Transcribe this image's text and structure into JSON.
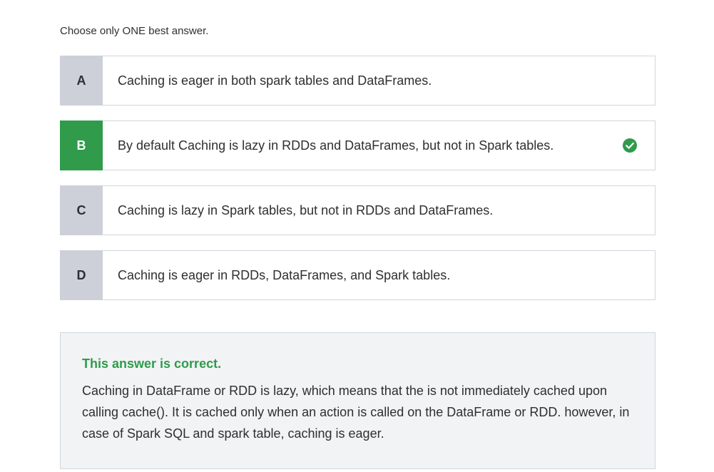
{
  "instruction": "Choose only ONE best answer.",
  "options": [
    {
      "letter": "A",
      "text": "Caching is eager in both spark tables and DataFrames.",
      "correct": false
    },
    {
      "letter": "B",
      "text": "By default Caching is lazy in RDDs and DataFrames, but not in Spark tables.",
      "correct": true
    },
    {
      "letter": "C",
      "text": "Caching is lazy in Spark tables, but not in RDDs and DataFrames.",
      "correct": false
    },
    {
      "letter": "D",
      "text": "Caching is eager in RDDs, DataFrames, and Spark tables.",
      "correct": false
    }
  ],
  "feedback": {
    "title": "This answer is correct.",
    "body": "Caching in DataFrame or RDD is lazy, which means that the is not immediately cached upon calling cache(). It is cached only when an action is called on the DataFrame or RDD. however, in case of Spark SQL and spark table, caching is eager."
  },
  "colors": {
    "correct": "#2f9b4b",
    "letter_bg": "#cdd0d8",
    "feedback_bg": "#f2f3f5"
  },
  "icons": {
    "correct_marker": "check-circle-icon"
  }
}
